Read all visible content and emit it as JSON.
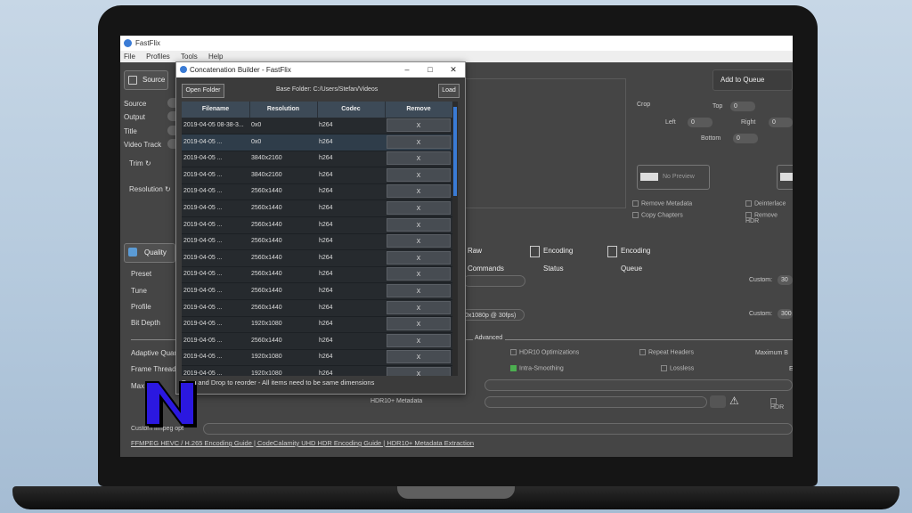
{
  "app": {
    "title": "FastFlix",
    "menu": [
      "File",
      "Profiles",
      "Tools",
      "Help"
    ]
  },
  "source": {
    "button": "Source",
    "labels": [
      "Source",
      "Output",
      "Title",
      "Video Track"
    ],
    "trim": "Trim",
    "resolution": "Resolution"
  },
  "toolbar": {
    "add_to_queue": "Add to Queue"
  },
  "crop": {
    "label": "Crop",
    "top_label": "Top",
    "top": "0",
    "left_label": "Left",
    "left": "0",
    "right_label": "Right",
    "right": "0",
    "bottom_label": "Bottom",
    "bottom": "0"
  },
  "options": {
    "no_preview": "No Preview",
    "remove_metadata": "Remove Metadata",
    "copy_chapters": "Copy Chapters",
    "deinterlace": "Deinterlace",
    "remove_hdr": "Remove HDR"
  },
  "tabs": {
    "raw_commands": "Raw Commands",
    "encoding_status": "Encoding Status",
    "encoding_queue": "Encoding Queue"
  },
  "quality": {
    "button": "Quality",
    "labels": [
      "Preset",
      "Tune",
      "Profile",
      "Bit Depth"
    ],
    "adaptive": "Adaptive Quan",
    "frame_threads": "Frame Threads",
    "max": "Max"
  },
  "encoder": {
    "custom_label": "Custom:",
    "custom_crf": "30",
    "custom_bitrate": "300",
    "bitrate_hint": "0x1080p @ 30fps)",
    "advanced": "Advanced",
    "hdr10_opt": "HDR10 Optimizations",
    "repeat_headers": "Repeat Headers",
    "max_b": "Maximum B",
    "intra_smoothing": "Intra-Smoothing",
    "lossless": "Lossless",
    "e_trunc": "E",
    "hdr10_metadata": "HDR10+ Metadata",
    "hdr_trunc": "HDR",
    "custom_ffmpeg": "Custom ffmpeg opt"
  },
  "links": {
    "text": "FFMPEG HEVC / H.265 Encoding Guide | CodeCalamity UHD HDR Encoding Guide | HDR10+ Metadata Extraction"
  },
  "dialog": {
    "title": "Concatenation Builder - FastFlix",
    "open_folder": "Open Folder",
    "base_folder": "Base Folder: C:/Users/Stefan/Videos",
    "load": "Load",
    "columns": [
      "Filename",
      "Resolution",
      "Codec",
      "Remove"
    ],
    "rows": [
      {
        "filename": "2019-04-05 08-38-3...",
        "resolution": "0x0",
        "codec": "h264",
        "remove": "X"
      },
      {
        "filename": "2019-04-05 ...",
        "resolution": "0x0",
        "codec": "h264",
        "remove": "X"
      },
      {
        "filename": "2019-04-05 ...",
        "resolution": "3840x2160",
        "codec": "h264",
        "remove": "X"
      },
      {
        "filename": "2019-04-05 ...",
        "resolution": "3840x2160",
        "codec": "h264",
        "remove": "X"
      },
      {
        "filename": "2019-04-05 ...",
        "resolution": "2560x1440",
        "codec": "h264",
        "remove": "X"
      },
      {
        "filename": "2019-04-05 ...",
        "resolution": "2560x1440",
        "codec": "h264",
        "remove": "X"
      },
      {
        "filename": "2019-04-05 ...",
        "resolution": "2560x1440",
        "codec": "h264",
        "remove": "X"
      },
      {
        "filename": "2019-04-05 ...",
        "resolution": "2560x1440",
        "codec": "h264",
        "remove": "X"
      },
      {
        "filename": "2019-04-05 ...",
        "resolution": "2560x1440",
        "codec": "h264",
        "remove": "X"
      },
      {
        "filename": "2019-04-05 ...",
        "resolution": "2560x1440",
        "codec": "h264",
        "remove": "X"
      },
      {
        "filename": "2019-04-05 ...",
        "resolution": "2560x1440",
        "codec": "h264",
        "remove": "X"
      },
      {
        "filename": "2019-04-05 ...",
        "resolution": "2560x1440",
        "codec": "h264",
        "remove": "X"
      },
      {
        "filename": "2019-04-05 ...",
        "resolution": "1920x1080",
        "codec": "h264",
        "remove": "X"
      },
      {
        "filename": "2019-04-05 ...",
        "resolution": "2560x1440",
        "codec": "h264",
        "remove": "X"
      },
      {
        "filename": "2019-04-05 ...",
        "resolution": "1920x1080",
        "codec": "h264",
        "remove": "X"
      },
      {
        "filename": "2019-04-05 ...",
        "resolution": "1920x1080",
        "codec": "h264",
        "remove": "X"
      }
    ],
    "hint": "Drag and Drop to reorder - All items need to be same dimensions"
  }
}
